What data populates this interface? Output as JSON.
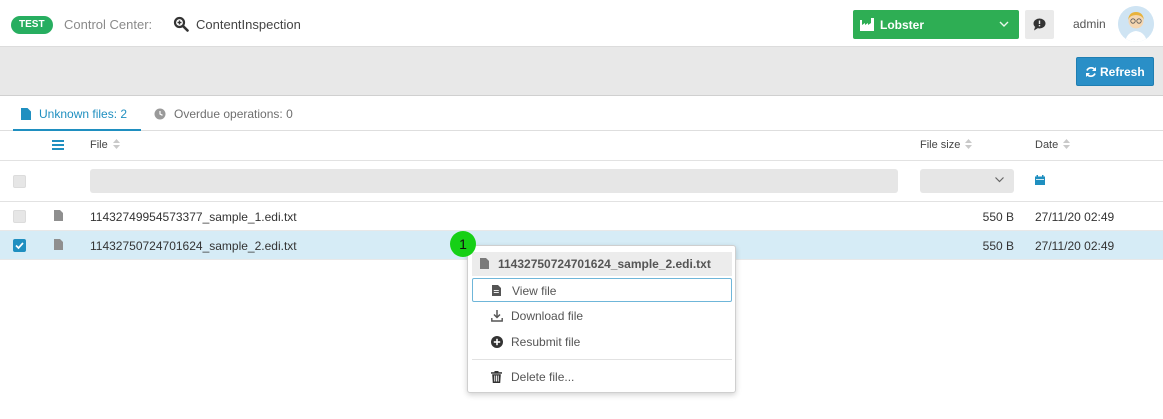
{
  "header": {
    "env_badge": "TEST",
    "app_title": "Control Center:",
    "page_name": "ContentInspection",
    "tenant": "Lobster",
    "user": "admin"
  },
  "toolbar": {
    "refresh_label": "Refresh"
  },
  "tabs": [
    {
      "label": "Unknown files: 2",
      "active": true
    },
    {
      "label": "Overdue operations: 0",
      "active": false
    }
  ],
  "table": {
    "columns": {
      "file": "File",
      "size": "File size",
      "date": "Date"
    },
    "filter": {
      "file_value": "",
      "size_value": ""
    },
    "rows": [
      {
        "file": "11432749954573377_sample_1.edi.txt",
        "size": "550 B",
        "date": "27/11/20 02:49",
        "selected": false
      },
      {
        "file": "11432750724701624_sample_2.edi.txt",
        "size": "550 B",
        "date": "27/11/20 02:49",
        "selected": true
      }
    ]
  },
  "step_marker": "1",
  "context_menu": {
    "title": "11432750724701624_sample_2.edi.txt",
    "items": [
      {
        "label": "View file",
        "icon": "file-icon"
      },
      {
        "label": "Download file",
        "icon": "download-icon"
      },
      {
        "label": "Resubmit file",
        "icon": "plus-circle-icon"
      },
      {
        "label": "Delete file...",
        "icon": "trash-icon"
      }
    ]
  },
  "colors": {
    "accent": "#1f8fc0",
    "tenant_green": "#2eae54",
    "env_green": "#27ae60",
    "selected_row": "#d6ecf6"
  }
}
